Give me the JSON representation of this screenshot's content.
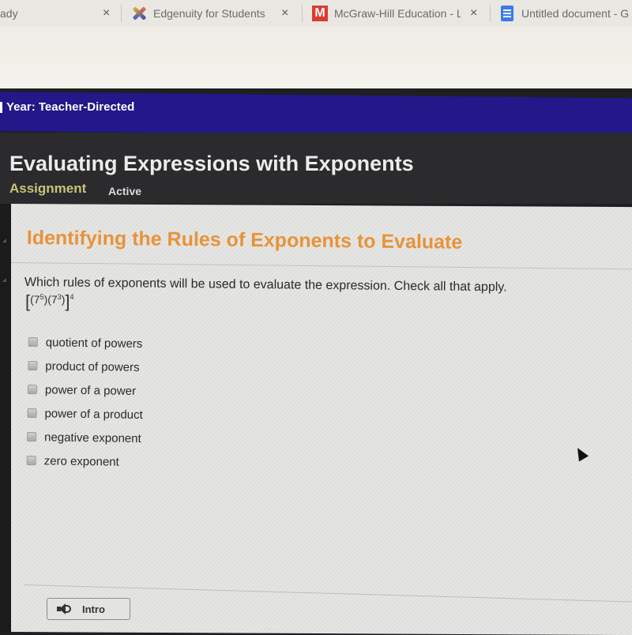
{
  "browser": {
    "tabs": [
      {
        "title": "ady",
        "icon": "partial-tab"
      },
      {
        "title": "Edgenuity for Students",
        "icon": "edgenuity-logo-icon"
      },
      {
        "title": "McGraw-Hill Education - L",
        "icon": "mcgraw-hill-icon",
        "icon_letter": "M"
      },
      {
        "title": "Untitled document - G",
        "icon": "google-docs-icon"
      }
    ],
    "close_glyph": "×"
  },
  "course": {
    "title": "Year: Teacher-Directed"
  },
  "header": {
    "title": "Evaluating Expressions with Exponents",
    "type_label": "Assignment",
    "status": "Active"
  },
  "activity": {
    "title": "Identifying the Rules of Exponents to Evaluate",
    "question": "Which rules of exponents will be used to evaluate the expression. Check all that apply.",
    "expression": {
      "open_bracket": "[",
      "base1": "(7",
      "exp1": "5",
      "close1": ")",
      "base2": "(7",
      "exp2": "3",
      "close2": ")",
      "close_bracket": "]",
      "outer_exp": "4"
    },
    "options": [
      {
        "label": "quotient of powers",
        "checked": false
      },
      {
        "label": "product of powers",
        "checked": false
      },
      {
        "label": "power of a power",
        "checked": false
      },
      {
        "label": "power of a product",
        "checked": false
      },
      {
        "label": "negative exponent",
        "checked": false
      },
      {
        "label": "zero exponent",
        "checked": false
      }
    ]
  },
  "footer": {
    "intro_label": "Intro"
  },
  "colors": {
    "course_bar": "#23178a",
    "header_bg": "#2b2b2d",
    "assignment_accent": "#c9c27a",
    "activity_title": "#e8923a"
  }
}
